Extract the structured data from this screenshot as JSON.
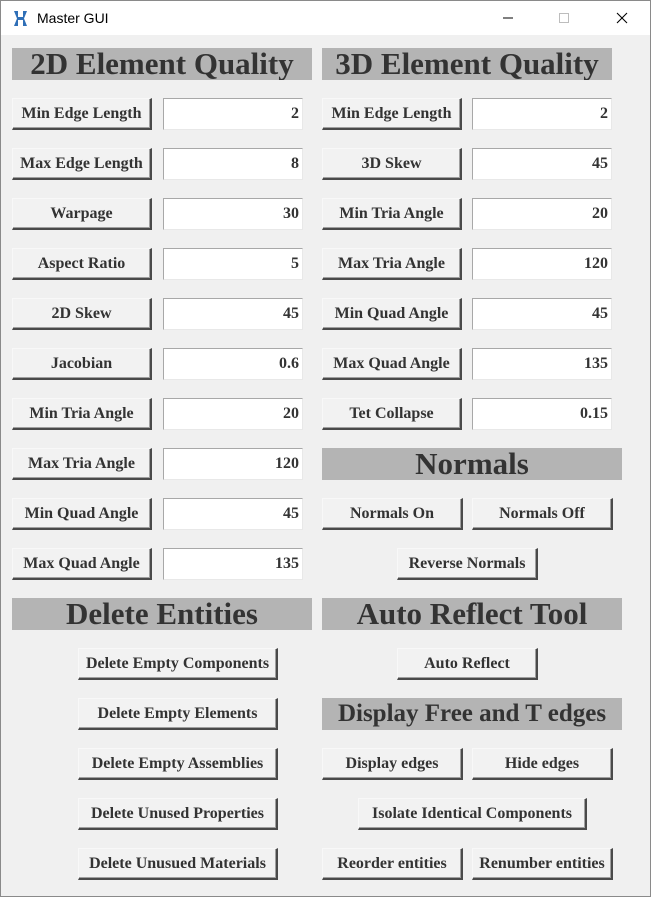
{
  "window": {
    "title": "Master GUI",
    "accent_color": "#2f6fb7"
  },
  "sections": {
    "quality_2d": {
      "title": "2D Element Quality",
      "rows": [
        {
          "label": "Min Edge Length",
          "value": "2"
        },
        {
          "label": "Max Edge Length",
          "value": "8"
        },
        {
          "label": "Warpage",
          "value": "30"
        },
        {
          "label": "Aspect Ratio",
          "value": "5"
        },
        {
          "label": "2D Skew",
          "value": "45"
        },
        {
          "label": "Jacobian",
          "value": "0.6"
        },
        {
          "label": "Min Tria Angle",
          "value": "20"
        },
        {
          "label": "Max Tria Angle",
          "value": "120"
        },
        {
          "label": "Min Quad Angle",
          "value": "45"
        },
        {
          "label": "Max Quad Angle",
          "value": "135"
        }
      ]
    },
    "quality_3d": {
      "title": "3D Element Quality",
      "rows": [
        {
          "label": "Min Edge Length",
          "value": "2"
        },
        {
          "label": "3D Skew",
          "value": "45"
        },
        {
          "label": "Min Tria Angle",
          "value": "20"
        },
        {
          "label": "Max Tria Angle",
          "value": "120"
        },
        {
          "label": "Min Quad Angle",
          "value": "45"
        },
        {
          "label": "Max Quad Angle",
          "value": "135"
        },
        {
          "label": "Tet Collapse",
          "value": "0.15"
        }
      ]
    },
    "normals": {
      "title": "Normals",
      "on_label": "Normals On",
      "off_label": "Normals Off",
      "reverse_label": "Reverse Normals"
    },
    "delete_entities": {
      "title": "Delete Entities",
      "buttons": [
        "Delete Empty Components",
        "Delete Empty Elements",
        "Delete Empty Assemblies",
        "Delete Unused Properties",
        "Delete Unusued Materials"
      ]
    },
    "auto_reflect": {
      "title": "Auto Reflect Tool",
      "button": "Auto Reflect"
    },
    "free_edges": {
      "title": "Display Free and T edges",
      "display_label": "Display edges",
      "hide_label": "Hide edges",
      "isolate_label": "Isolate Identical Components",
      "reorder_label": "Reorder entities",
      "renumber_label": "Renumber entities"
    }
  }
}
